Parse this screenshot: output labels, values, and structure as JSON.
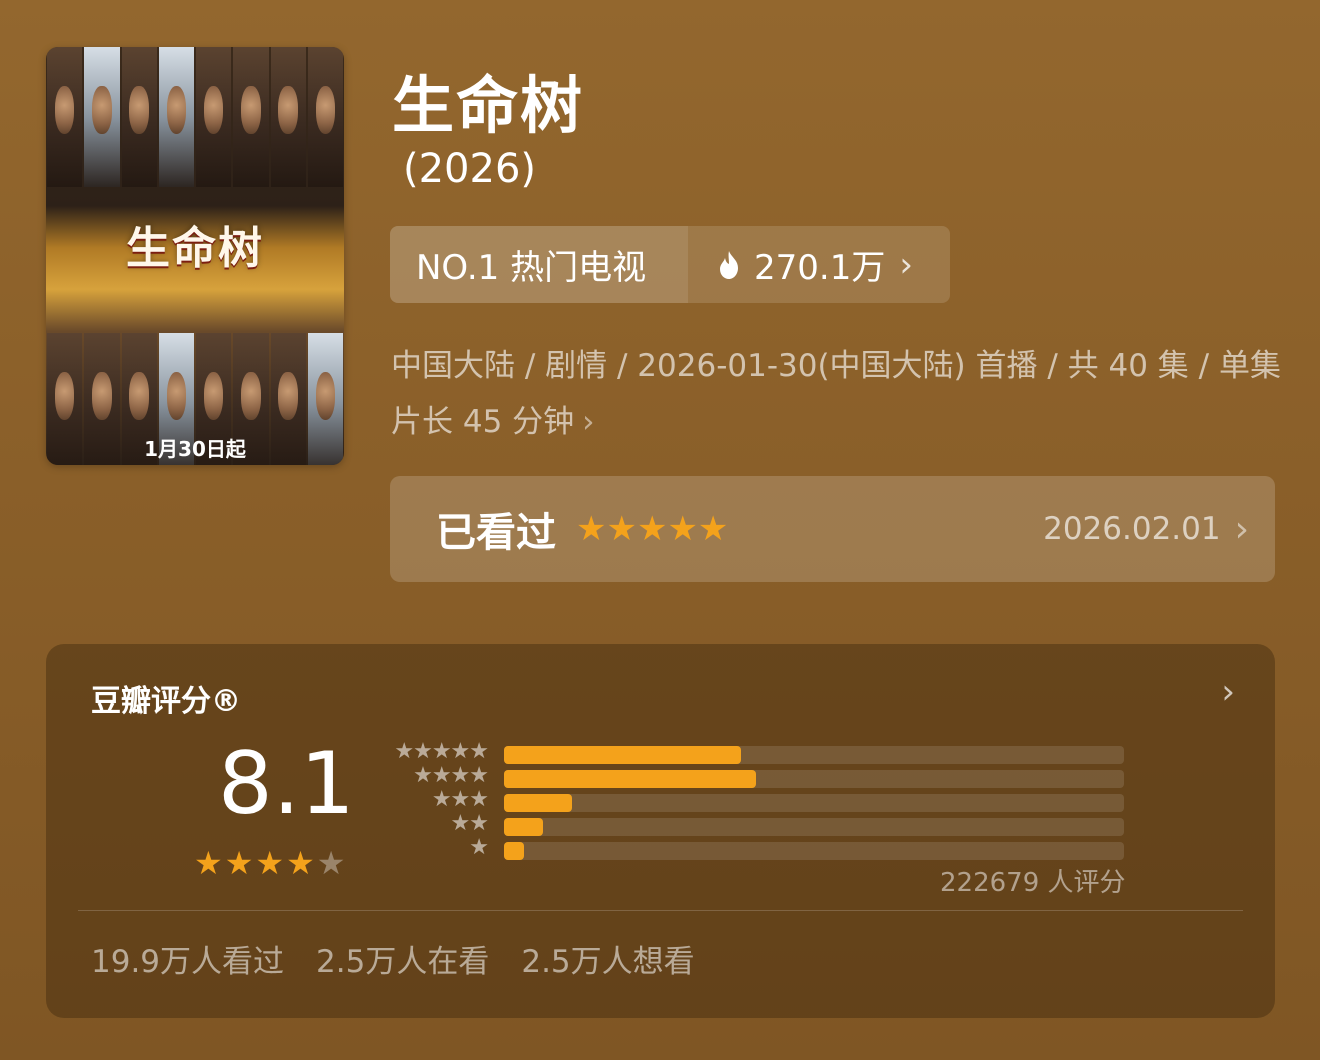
{
  "poster": {
    "logo": "生命树",
    "date_text": "1月30日起"
  },
  "title": "生命树",
  "year": "(2026)",
  "rank": {
    "label": "NO.1 热门电视",
    "heat": "270.1万"
  },
  "meta": "中国大陆 / 剧情 / 2026-01-30(中国大陆) 首播 / 共 40 集 / 单集片长 45 分钟",
  "watched": {
    "label": "已看过",
    "user_rating_stars": 5,
    "date": "2026.02.01"
  },
  "douban": {
    "header": "豆瓣评分®",
    "score": "8.1",
    "score_stars": 4,
    "rating_distribution": [
      {
        "stars": 5,
        "fraction": 0.383
      },
      {
        "stars": 4,
        "fraction": 0.407
      },
      {
        "stars": 3,
        "fraction": 0.109
      },
      {
        "stars": 2,
        "fraction": 0.063
      },
      {
        "stars": 1,
        "fraction": 0.032
      }
    ],
    "rating_count": "222679 人评分",
    "footer": {
      "watched": "19.9万人看过",
      "watching": "2.5万人在看",
      "want": "2.5万人想看"
    }
  },
  "colors": {
    "accent": "#f4a21b",
    "background": "#8a5f29"
  }
}
